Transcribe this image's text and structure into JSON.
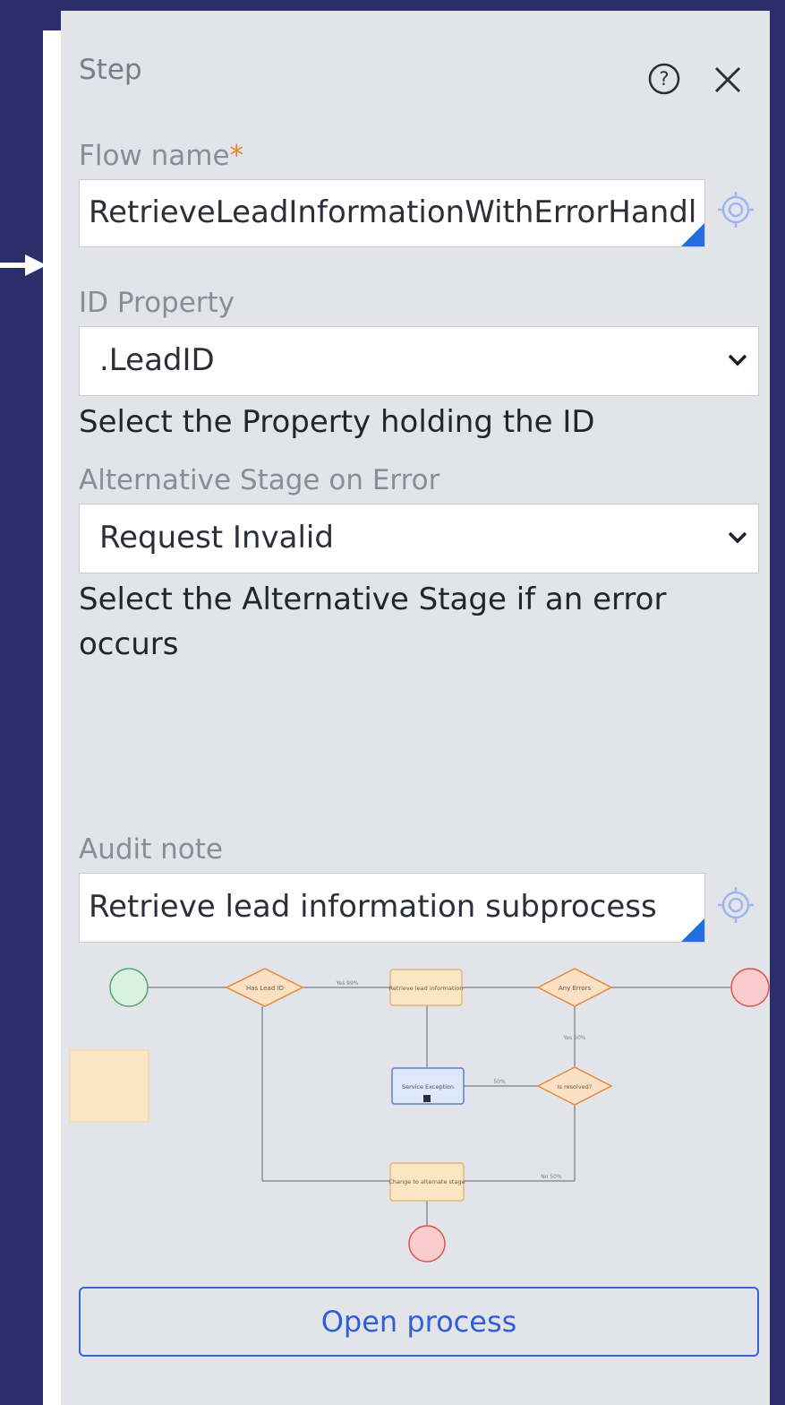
{
  "panel": {
    "title": "Step",
    "help_icon": "help-circle-icon",
    "close_icon": "close-icon"
  },
  "flow_name": {
    "label": "Flow name",
    "required_mark": "*",
    "value": "RetrieveLeadInformationWithErrorHandling",
    "target_icon": "crosshair-target-icon"
  },
  "id_property": {
    "label": "ID Property",
    "selected": ".LeadID",
    "hint": "Select the Property holding the ID"
  },
  "alt_stage": {
    "label": "Alternative Stage on Error",
    "selected": "Request Invalid",
    "hint_line1": "Select the Alternative Stage if an error",
    "hint_line2": "occurs"
  },
  "audit_note": {
    "label": "Audit note",
    "value": "Retrieve lead information subprocess",
    "target_icon": "crosshair-target-icon"
  },
  "diagram": {
    "note_text": "",
    "nodes": [
      {
        "id": "d1",
        "text": "Has Lead ID"
      },
      {
        "id": "a1",
        "text": "Retrieve lead information"
      },
      {
        "id": "d2",
        "text": "Any Errors"
      },
      {
        "id": "a2",
        "text": "Service Exception"
      },
      {
        "id": "d3",
        "text": "Is resolved?"
      },
      {
        "id": "a3",
        "text": "Change to alternate stage"
      }
    ],
    "edges": [
      {
        "text": "Yes 99%"
      },
      {
        "text": "Yes 50%"
      },
      {
        "text": "50%"
      },
      {
        "text": "No 50%"
      }
    ]
  },
  "open_button": "Open process",
  "colors": {
    "background": "#2a2f6b",
    "panel": "#e3e4ea",
    "accent": "#2f5fd6",
    "required": "#e0882a",
    "start_event": "#d9f2df",
    "end_event": "#f8cccc",
    "decision": "#fbe1c3",
    "activity": "#fbe6c4",
    "service": "#dfe8fb"
  }
}
